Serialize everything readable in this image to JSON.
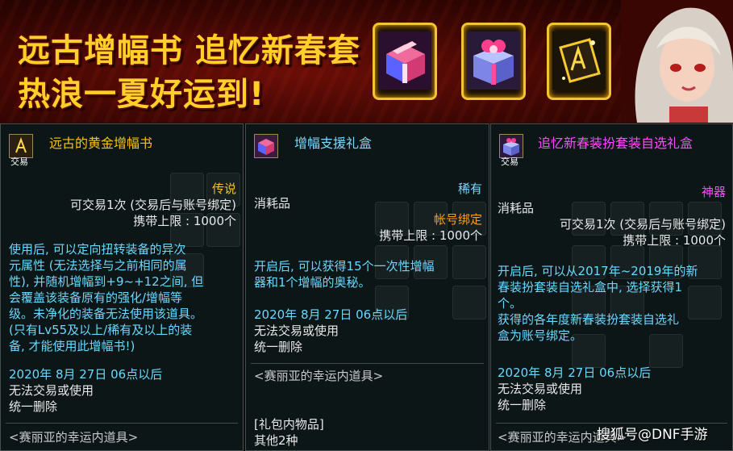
{
  "banner": {
    "line1": "远古增幅书 追忆新春套",
    "line2": "热浪一夏好运到!"
  },
  "items": [
    {
      "name": "远古的黄金增幅书",
      "trade_tag": "交易",
      "rarity": "传说",
      "trade_rule": "可交易1次 (交易后与账号绑定)",
      "carry_limit": "携带上限 : 1000个",
      "description": [
        "使用后, 可以定向扭转装备的异次",
        "元属性 (无法选择与之前相同的属",
        "性), 并随机增幅到+9~+12之间, 但",
        "会覆盖该装备原有的强化/增幅等",
        "级。未净化的装备无法使用该道具。",
        "(只有Lv55及以上/稀有及以上的装",
        "备, 才能使用此增幅书!)"
      ],
      "date": "2020年 8月 27日 06点以后",
      "expire_1": "无法交易或使用",
      "expire_2": "统一删除",
      "source": "<赛丽亚的幸运内道具>"
    },
    {
      "name": "增幅支援礼盒",
      "rarity": "稀有",
      "category": "消耗品",
      "bind": "帐号绑定",
      "carry_limit": "携带上限 : 1000个",
      "description": [
        "开启后, 可以获得15个一次性增幅",
        "器和1个增幅的奥秘。"
      ],
      "date": "2020年 8月 27日 06点以后",
      "expire_1": "无法交易或使用",
      "expire_2": "统一删除",
      "source": "<赛丽亚的幸运内道具>",
      "contents_title": "[礼包内物品]",
      "contents_other": "其他2种"
    },
    {
      "name": "追忆新春装扮套装自选礼盒",
      "trade_tag": "交易",
      "rarity": "神器",
      "category": "消耗品",
      "trade_rule": "可交易1次 (交易后与账号绑定)",
      "carry_limit": "携带上限 : 1000个",
      "description": [
        "开启后, 可以从2017年~2019年的新",
        "春装扮套装自选礼盒中, 选择获得1",
        "个。",
        "获得的各年度新春装扮套装自选礼",
        "盒为账号绑定。"
      ],
      "date": "2020年 8月 27日 06点以后",
      "expire_1": "无法交易或使用",
      "expire_2": "统一删除",
      "source": "<赛丽亚的幸运内道具>"
    }
  ],
  "watermark": "搜狐号@DNF手游",
  "colors": {
    "legendary": "#f9c21a",
    "rare": "#7bd8ff",
    "artifact": "#ff4aff",
    "description": "#69d8ff"
  }
}
